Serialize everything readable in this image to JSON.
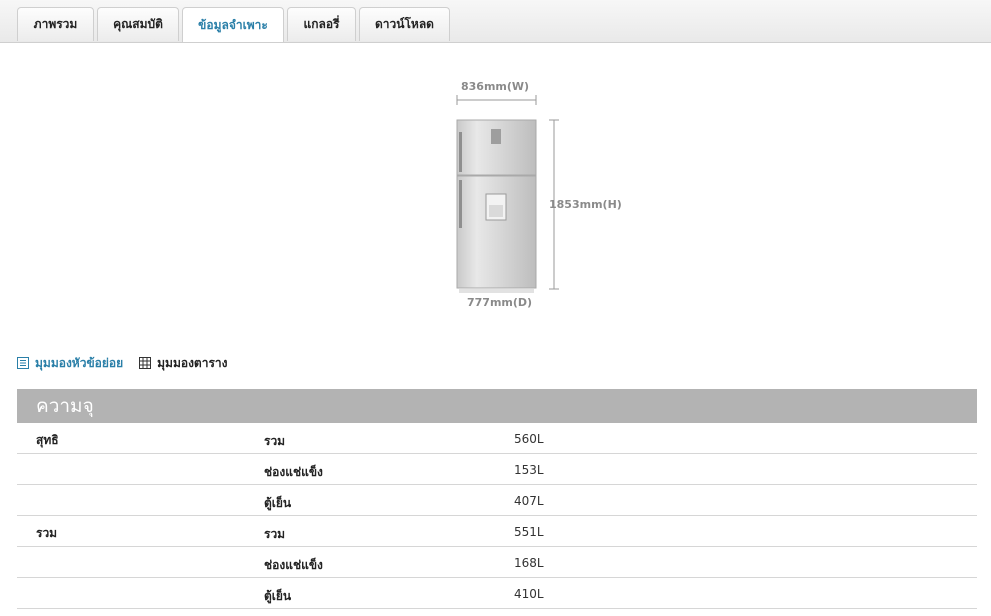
{
  "tabs": [
    {
      "label": "ภาพรวม",
      "active": false
    },
    {
      "label": "คุณสมบัติ",
      "active": false
    },
    {
      "label": "ข้อมูลจำเพาะ",
      "active": true
    },
    {
      "label": "แกลอรี่",
      "active": false
    },
    {
      "label": "ดาวน์โหลด",
      "active": false
    }
  ],
  "dimensions": {
    "width": "836mm(W)",
    "height": "1853mm(H)",
    "depth": "777mm(D)"
  },
  "view_toggle": {
    "list_view": "มุมมองหัวข้อย่อย",
    "table_view": "มุมมองตาราง"
  },
  "section": {
    "title": "ความจุ",
    "rows": [
      {
        "group": "สุทธิ",
        "item": "รวม",
        "value": "560L"
      },
      {
        "group": "",
        "item": "ช่องแช่แข็ง",
        "value": "153L"
      },
      {
        "group": "",
        "item": "ตู้เย็น",
        "value": "407L"
      },
      {
        "group": "รวม",
        "item": "รวม",
        "value": "551L"
      },
      {
        "group": "",
        "item": "ช่องแช่แข็ง",
        "value": "168L"
      },
      {
        "group": "",
        "item": "ตู้เย็น",
        "value": "410L"
      }
    ]
  },
  "colors": {
    "accent": "#2a7fa8",
    "header_bg": "#b3b3b3"
  }
}
